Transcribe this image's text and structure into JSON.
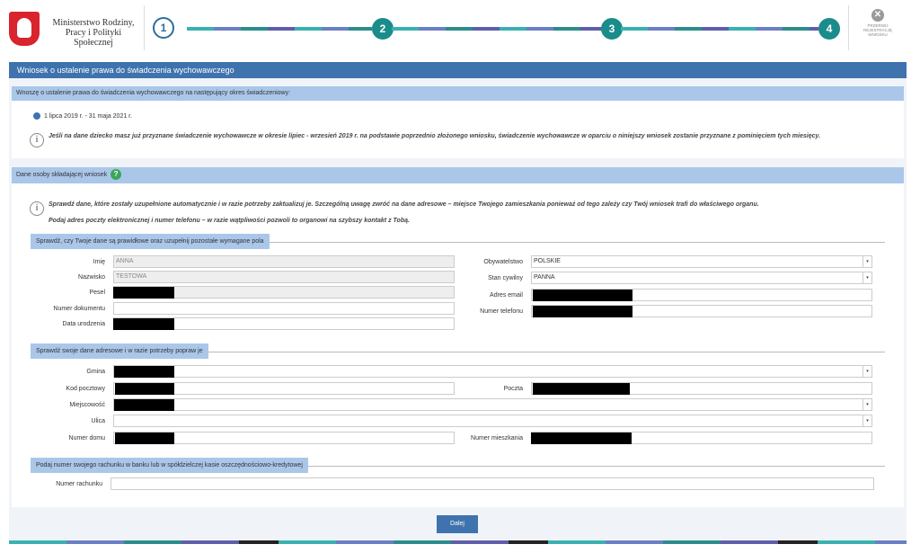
{
  "header": {
    "ministry_line1": "Ministerstwo Rodziny,",
    "ministry_line2": "Pracy i Polityki Społecznej",
    "steps": [
      "1",
      "2",
      "3",
      "4"
    ],
    "cancel_line1": "PRZERWIJ",
    "cancel_line2": "REJESTRACJĘ",
    "cancel_line3": "WNIOSKU"
  },
  "page_title": "Wniosek o ustalenie prawa do świadczenia wychowawczego",
  "period": {
    "heading": "Wnoszę o ustalenie prawa do świadczenia wychowawczego na następujący okres świadczeniowy:",
    "option": "1 lipca 2019 r. - 31 maja 2021 r.",
    "info": "Jeśli na dane dziecko masz już przyznane świadczenie wychowawcze w okresie lipiec - wrzesień 2019 r. na podstawie poprzednio złożonego wniosku, świadczenie wychowawcze w oparciu o niniejszy wniosek zostanie przyznane z pominięciem tych miesięcy."
  },
  "applicant": {
    "heading": "Dane osoby składającej wniosek",
    "info1": "Sprawdź dane, które zostały uzupełnione automatycznie i w razie potrzeby zaktualizuj je. Szczególną uwagę zwróć na dane adresowe – miejsce Twojego zamieszkania ponieważ od tego zależy czy Twój wniosek trafi do właściwego organu.",
    "info2": "Podaj adres poczty elektronicznej i numer telefonu – w razie wątpliwości pozwoli to organowi na szybszy kontakt z Tobą.",
    "personal_tab": "Sprawdź, czy Twoje dane są prawidłowe oraz uzupełnij pozostałe wymagane pola",
    "fields": {
      "imie_label": "Imię",
      "imie_value": "ANNA",
      "nazwisko_label": "Nazwisko",
      "nazwisko_value": "TESTOWA",
      "pesel_label": "Pesel",
      "dokument_label": "Numer dokumentu",
      "data_label": "Data urodzenia",
      "obywatelstwo_label": "Obywatelstwo",
      "obywatelstwo_value": "POLSKIE",
      "stan_label": "Stan cywilny",
      "stan_value": "PANNA",
      "email_label": "Adres email",
      "telefon_label": "Numer telefonu"
    },
    "address_tab": "Sprawdź swoje dane adresowe i w razie potrzeby popraw je",
    "address": {
      "gmina_label": "Gmina",
      "kod_label": "Kod pocztowy",
      "poczta_label": "Poczta",
      "miejscowosc_label": "Miejscowość",
      "ulica_label": "Ulica",
      "dom_label": "Numer domu",
      "mieszkanie_label": "Numer mieszkania"
    },
    "bank_tab": "Podaj numer swojego rachunku w banku lub w spółdzielczej kasie oszczędnościowo-kredytowej",
    "rachunek_label": "Numer rachunku"
  },
  "next_button": "Dalej",
  "icons": {
    "dropdown": "▾",
    "info": "i",
    "help": "?",
    "close": "✕"
  }
}
